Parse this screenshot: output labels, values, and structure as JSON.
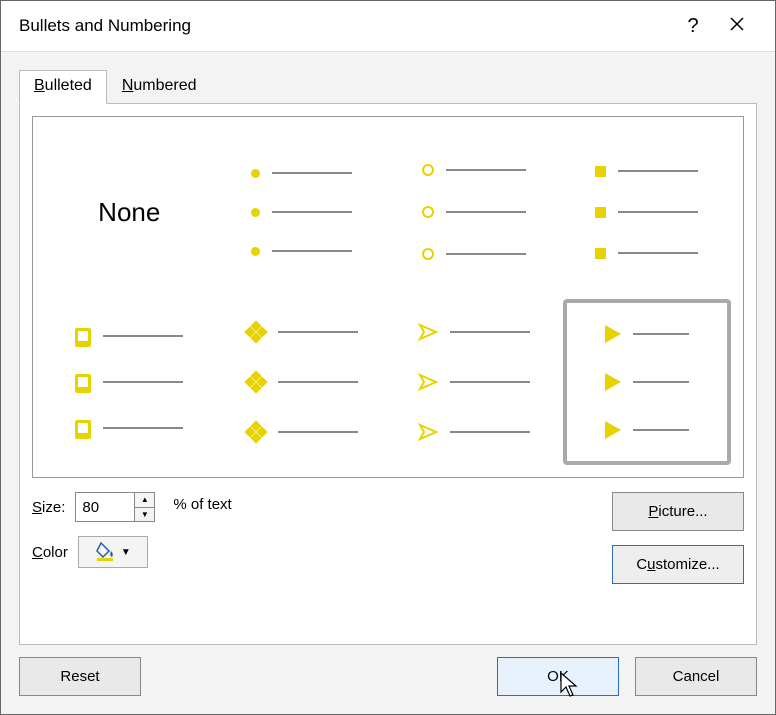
{
  "title": "Bullets and Numbering",
  "tabs": {
    "bulleted": {
      "prefix": "B",
      "rest": "ulleted"
    },
    "numbered": {
      "prefix": "N",
      "rest": "umbered"
    }
  },
  "gallery": {
    "none": "None"
  },
  "size": {
    "label_prefix": "S",
    "label_rest": "ize:",
    "value": "80",
    "suffix": "% of text"
  },
  "color": {
    "label": "Color",
    "value": "#e6d300"
  },
  "buttons": {
    "picture_prefix": "P",
    "picture_rest": "icture...",
    "customize_pre": "C",
    "customize_u": "u",
    "customize_post": "stomize...",
    "reset": "Reset",
    "ok": "OK",
    "cancel": "Cancel"
  }
}
